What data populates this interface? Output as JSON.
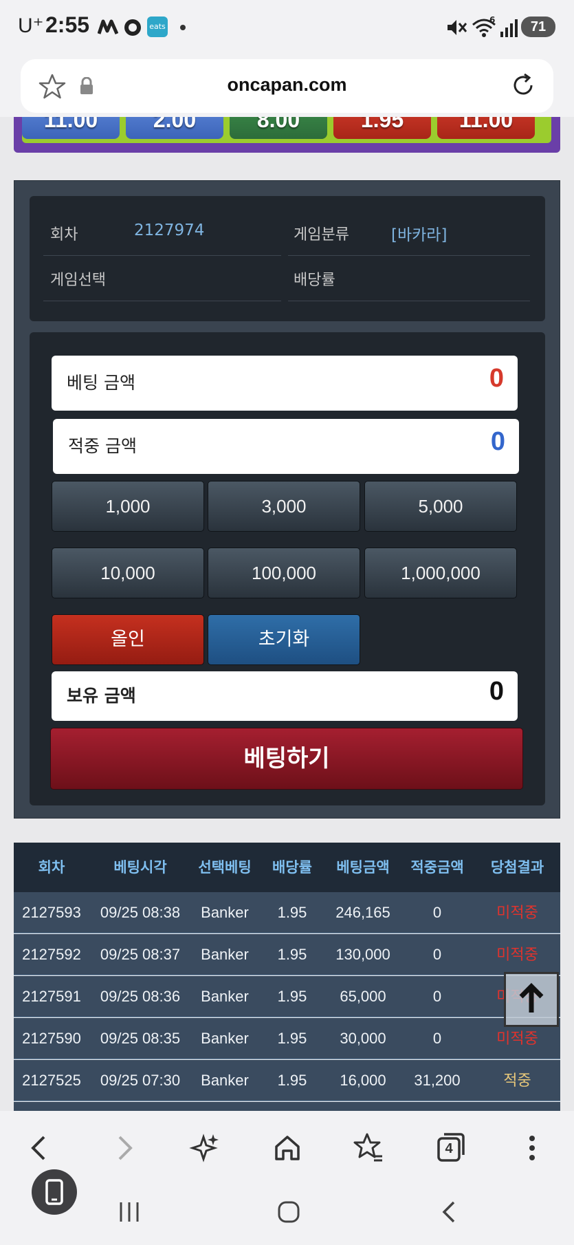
{
  "status_bar": {
    "carrier": "U⁺",
    "time": "2:55",
    "notif_icons": [
      "maps-icon",
      "chatgpt-icon",
      "eats-icon"
    ],
    "eats_label": "eats",
    "battery": "71",
    "wifi_badge": "6"
  },
  "browser": {
    "url": "oncapan.com"
  },
  "odds": [
    "11.00",
    "2.00",
    "8.00",
    "1.95",
    "11.00"
  ],
  "info": {
    "round_label": "회차",
    "round_value": "2127974",
    "category_label": "게임분류",
    "category_value": "[바카라]",
    "selection_label": "게임선택",
    "selection_value": "",
    "rate_label": "배당률",
    "rate_value": ""
  },
  "form": {
    "bet_amount_label": "베팅 금액",
    "bet_amount_value": "0",
    "win_amount_label": "적중 금액",
    "win_amount_value": "0",
    "chips": [
      "1,000",
      "3,000",
      "5,000",
      "10,000",
      "100,000",
      "1,000,000"
    ],
    "allin_label": "올인",
    "reset_label": "초기화",
    "balance_label": "보유 금액",
    "balance_value": "0",
    "submit_label": "베팅하기"
  },
  "history": {
    "headers": [
      "회차",
      "베팅시각",
      "선택베팅",
      "배당률",
      "베팅금액",
      "적중금액",
      "당첨결과"
    ],
    "rows": [
      [
        "2127593",
        "09/25 08:38",
        "Banker",
        "1.95",
        "246,165",
        "0",
        "미적중"
      ],
      [
        "2127592",
        "09/25 08:37",
        "Banker",
        "1.95",
        "130,000",
        "0",
        "미적중"
      ],
      [
        "2127591",
        "09/25 08:36",
        "Banker",
        "1.95",
        "65,000",
        "0",
        "미적중"
      ],
      [
        "2127590",
        "09/25 08:35",
        "Banker",
        "1.95",
        "30,000",
        "0",
        "미적중"
      ],
      [
        "2127525",
        "09/25 07:30",
        "Banker",
        "1.95",
        "16,000",
        "31,200",
        "적중"
      ]
    ]
  },
  "bottom_nav": {
    "tab_count": "4"
  },
  "colors": {
    "bet_amount": "#d63a2c",
    "win_amount": "#3366cc",
    "miss": "#e0332d",
    "hit": "#e8c87a"
  }
}
